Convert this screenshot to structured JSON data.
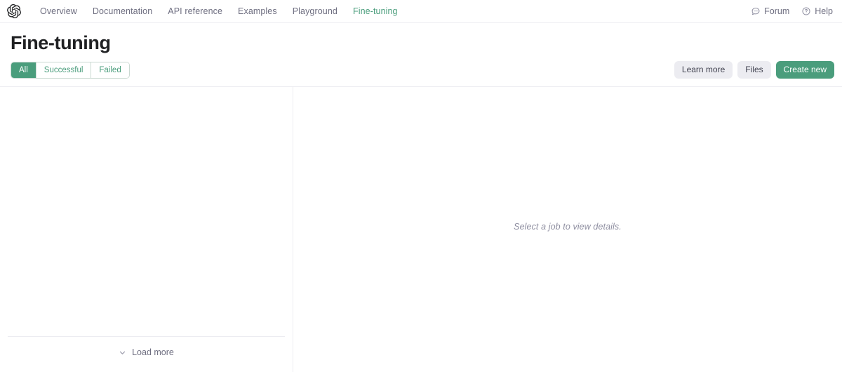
{
  "topbar": {
    "logo_icon": "openai-logo-icon",
    "nav_links": [
      {
        "label": "Overview",
        "active": false
      },
      {
        "label": "Documentation",
        "active": false
      },
      {
        "label": "API reference",
        "active": false
      },
      {
        "label": "Examples",
        "active": false
      },
      {
        "label": "Playground",
        "active": false
      },
      {
        "label": "Fine-tuning",
        "active": true
      }
    ],
    "right_actions": [
      {
        "label": "Forum",
        "icon": "chat-bubble-icon"
      },
      {
        "label": "Help",
        "icon": "question-circle-icon"
      }
    ]
  },
  "page": {
    "title": "Fine-tuning"
  },
  "filters": {
    "segments": [
      {
        "label": "All",
        "selected": true
      },
      {
        "label": "Successful",
        "selected": false
      },
      {
        "label": "Failed",
        "selected": false
      }
    ]
  },
  "actions": {
    "learn_more_label": "Learn more",
    "files_label": "Files",
    "create_new_label": "Create new"
  },
  "job_list": {
    "items": [],
    "load_more_label": "Load more",
    "load_more_icon": "chevron-down-icon"
  },
  "detail": {
    "empty_message": "Select a job to view details."
  },
  "colors": {
    "accent_green": "#4a9d7c",
    "border_gray": "#ececf1",
    "text_muted": "#6e6e80",
    "text_placeholder": "#8e8ea0",
    "button_gray": "#ececf1"
  }
}
